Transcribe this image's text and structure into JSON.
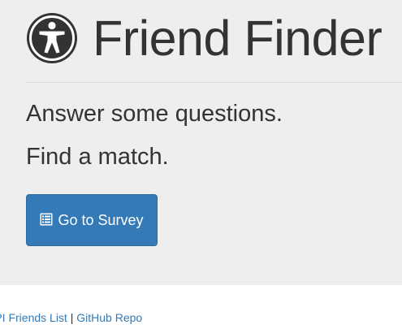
{
  "header": {
    "logo_icon": "universal-access-icon",
    "title": "Friend Finder"
  },
  "intro": {
    "line1": "Answer some questions.",
    "line2": "Find a match."
  },
  "cta": {
    "icon": "list-alt-icon",
    "label": "Go to Survey",
    "color": "#337ab7"
  },
  "footer": {
    "link1": "API Friends List",
    "separator": "|",
    "link2": "GitHub Repo",
    "link_color": "#337ab7"
  },
  "colors": {
    "jumbotron_bg": "#eeeeee",
    "text": "#333333"
  }
}
